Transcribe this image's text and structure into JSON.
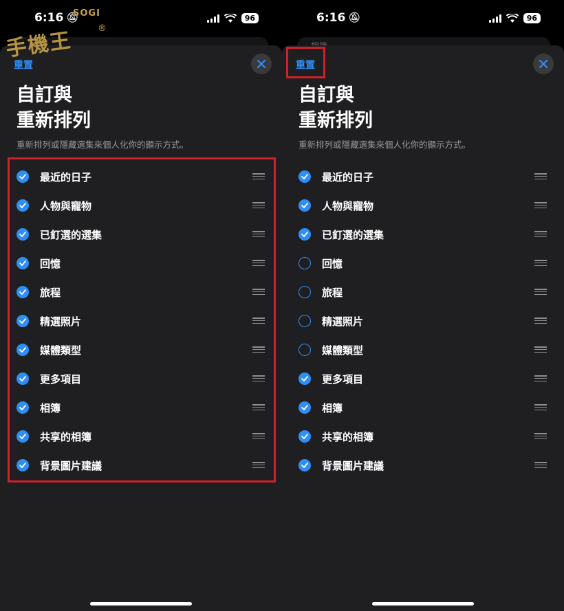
{
  "status_bar": {
    "time": "6:16",
    "battery": "96"
  },
  "behind_card_text": "相簿",
  "watermark": {
    "brand": "SOGI",
    "registered": "®",
    "glyphs": "手機王"
  },
  "panels": {
    "left": {
      "reset_label": "重置",
      "title_line1": "自訂與",
      "title_line2": "重新排列",
      "subtitle": "重新排列或隱藏選集來個人化你的顯示方式。",
      "items": [
        {
          "label": "最近的日子",
          "checked": true
        },
        {
          "label": "人物與寵物",
          "checked": true
        },
        {
          "label": "已釘選的選集",
          "checked": true
        },
        {
          "label": "回憶",
          "checked": true
        },
        {
          "label": "旅程",
          "checked": true
        },
        {
          "label": "精選照片",
          "checked": true
        },
        {
          "label": "媒體類型",
          "checked": true
        },
        {
          "label": "更多項目",
          "checked": true
        },
        {
          "label": "相簿",
          "checked": true
        },
        {
          "label": "共享的相簿",
          "checked": true
        },
        {
          "label": "背景圖片建議",
          "checked": true
        }
      ]
    },
    "right": {
      "reset_label": "重置",
      "title_line1": "自訂與",
      "title_line2": "重新排列",
      "subtitle": "重新排列或隱藏選集來個人化你的顯示方式。",
      "items": [
        {
          "label": "最近的日子",
          "checked": true
        },
        {
          "label": "人物與寵物",
          "checked": true
        },
        {
          "label": "已釘選的選集",
          "checked": true
        },
        {
          "label": "回憶",
          "checked": false
        },
        {
          "label": "旅程",
          "checked": false
        },
        {
          "label": "精選照片",
          "checked": false
        },
        {
          "label": "媒體類型",
          "checked": false
        },
        {
          "label": "更多項目",
          "checked": true
        },
        {
          "label": "相簿",
          "checked": true
        },
        {
          "label": "共享的相簿",
          "checked": true
        },
        {
          "label": "背景圖片建議",
          "checked": true
        }
      ]
    }
  },
  "colors": {
    "accent": "#2f8ef5",
    "highlight": "#d0202a",
    "sheet": "#1f1f21"
  }
}
